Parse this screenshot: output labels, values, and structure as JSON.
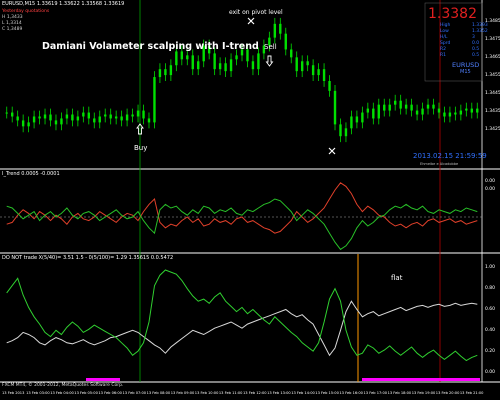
{
  "chart_window": {
    "title": "EURUSD,M15",
    "ohlc": "1.33619 1.33622 1.33568 1.33619",
    "lines": [
      "Yesterday quotations",
      "H 1,3433",
      "L 1,3314",
      "C 1,3489"
    ]
  },
  "overlay_title": "Damiani Volameter scalping with I-trend",
  "annotations": {
    "buy": "Buy",
    "sell": "Sell",
    "exit_pivot": "exit on pivot level",
    "flat": "flat"
  },
  "price_panel": {
    "big_price": "1.3382",
    "stats": [
      {
        "label": "High",
        "value": "1.3393"
      },
      {
        "label": "Low",
        "value": "1.3352"
      },
      {
        "label": "H/L",
        "value": "3"
      },
      {
        "label": "Sprd",
        "value": "0.0"
      },
      {
        "label": "R2",
        "value": "0.5"
      },
      {
        "label": "R1",
        "value": "0.5"
      }
    ],
    "symbol": "EURUSD",
    "timeframe": "M15",
    "datetime": "2013.02.15  21:59:59",
    "footer": "Ehmeibe e Alcadobbe"
  },
  "itrend_panel": {
    "title": "I_Trend 0.0005 -0.0001"
  },
  "damiani_panel": {
    "title": "DO NOT trade X(5/40)= 3.51 1.5 - 0(5/100)= 1.29 1.35615 0.0.5472"
  },
  "footer_copyright": "FXCM MT4, © 2001-2012, MetaQuotes Software Corp.",
  "y_axis_main": [
    "1.3485",
    "1.3475",
    "1.3465",
    "1.3455",
    "1.3445",
    "1.3435",
    "1.3425"
  ],
  "y_axis_itrend": [
    "0.00",
    "0.00"
  ],
  "y_axis_damiani": [
    "1.00",
    "0.80",
    "0.60",
    "0.40",
    "0.20",
    "0.00"
  ],
  "x_axis_labels": [
    "13 Feb 2013",
    "13 Feb 03:00",
    "13 Feb 04:00",
    "13 Feb 05:00",
    "13 Feb 06:00",
    "13 Feb 07:00",
    "13 Feb 08:00",
    "13 Feb 09:00",
    "13 Feb 10:00",
    "13 Feb 11:00",
    "13 Feb 12:00",
    "13 Feb 13:00",
    "13 Feb 14:00",
    "13 Feb 15:00",
    "13 Feb 16:00",
    "13 Feb 17:00",
    "13 Feb 18:00",
    "13 Feb 19:00",
    "13 Feb 20:00",
    "13 Feb 21:00"
  ],
  "colors": {
    "bg": "#000000",
    "candle": "#00e000",
    "itrend_green": "#28c028",
    "itrend_red": "#e0402a",
    "damiani_green": "#30d030",
    "damiani_white": "#d8d8d8",
    "price_red": "#e02020",
    "accent_blue": "#2050ff",
    "vline_green": "#00a000",
    "vline_red": "#b00000",
    "vline_orange": "#ff9900",
    "magenta": "#ff00ff"
  },
  "chart_data": {
    "type": "line",
    "candles_close": [
      1.3444,
      1.3442,
      1.344,
      1.3437,
      1.3439,
      1.3442,
      1.3441,
      1.3443,
      1.344,
      1.3438,
      1.3441,
      1.3443,
      1.344,
      1.3442,
      1.3444,
      1.3441,
      1.3439,
      1.3442,
      1.3443,
      1.3441,
      1.3442,
      1.344,
      1.3443,
      1.3442,
      1.3445,
      1.3441,
      1.3439,
      1.3462,
      1.3466,
      1.3463,
      1.3468,
      1.3475,
      1.3471,
      1.3473,
      1.3466,
      1.347,
      1.3478,
      1.3474,
      1.3466,
      1.3469,
      1.3465,
      1.3471,
      1.3473,
      1.3476,
      1.347,
      1.3466,
      1.3474,
      1.3478,
      1.3482,
      1.3489,
      1.3484,
      1.3476,
      1.3472,
      1.3465,
      1.347,
      1.3468,
      1.3463,
      1.3466,
      1.346,
      1.3455,
      1.3438,
      1.3432,
      1.3436,
      1.3442,
      1.3439,
      1.3444,
      1.3446,
      1.3441,
      1.3448,
      1.3445,
      1.3448,
      1.345,
      1.3446,
      1.3448,
      1.3445,
      1.3443,
      1.3446,
      1.3448,
      1.3446,
      1.3444,
      1.3442,
      1.3444,
      1.3443,
      1.3445,
      1.3446,
      1.3444,
      1.3446
    ],
    "itrend_green": [
      0.6,
      0.5,
      0.2,
      -0.1,
      0.1,
      0.3,
      -0.2,
      0.1,
      0.3,
      0.0,
      0.2,
      0.5,
      0.1,
      -0.1,
      0.2,
      0.3,
      0.1,
      -0.2,
      0.0,
      0.2,
      0.4,
      0.1,
      -0.1,
      0.0,
      0.3,
      -0.2,
      -0.6,
      -0.9,
      0.4,
      0.7,
      0.5,
      0.6,
      0.3,
      0.1,
      0.4,
      0.2,
      0.6,
      0.5,
      0.2,
      0.4,
      0.3,
      0.5,
      0.2,
      0.1,
      0.4,
      0.3,
      0.5,
      0.7,
      0.8,
      1.0,
      0.9,
      0.6,
      0.3,
      -0.2,
      0.1,
      0.4,
      0.2,
      -0.1,
      -0.4,
      -0.9,
      -1.4,
      -1.8,
      -1.6,
      -1.2,
      -0.6,
      -0.2,
      -0.5,
      -0.3,
      0.0,
      0.1,
      0.4,
      0.6,
      0.5,
      0.7,
      0.5,
      0.4,
      0.6,
      0.3,
      0.2,
      0.4,
      0.3,
      0.2,
      0.4,
      0.3,
      0.5,
      0.4,
      0.3
    ],
    "itrend_red": [
      -0.4,
      -0.3,
      0.1,
      0.4,
      0.2,
      -0.1,
      0.3,
      0.1,
      -0.2,
      0.1,
      -0.1,
      -0.4,
      0.0,
      0.2,
      -0.1,
      -0.2,
      0.0,
      0.3,
      0.1,
      -0.1,
      -0.3,
      0.0,
      0.2,
      0.1,
      -0.2,
      0.3,
      0.7,
      1.0,
      -0.3,
      -0.6,
      -0.4,
      -0.5,
      -0.2,
      0.0,
      -0.3,
      -0.1,
      -0.5,
      -0.4,
      -0.1,
      -0.3,
      -0.2,
      -0.4,
      -0.1,
      0.0,
      -0.3,
      -0.2,
      -0.4,
      -0.6,
      -0.7,
      -0.9,
      -0.8,
      -0.5,
      -0.2,
      0.3,
      0.0,
      -0.3,
      -0.1,
      0.2,
      0.5,
      1.0,
      1.5,
      1.9,
      1.7,
      1.3,
      0.7,
      0.3,
      0.6,
      0.4,
      0.1,
      0.0,
      -0.3,
      -0.5,
      -0.4,
      -0.6,
      -0.4,
      -0.3,
      -0.5,
      -0.2,
      -0.1,
      -0.3,
      -0.2,
      -0.1,
      -0.3,
      -0.2,
      -0.4,
      -0.3,
      -0.2
    ],
    "damiani_green": [
      0.78,
      0.85,
      0.92,
      0.76,
      0.64,
      0.55,
      0.48,
      0.4,
      0.36,
      0.42,
      0.38,
      0.45,
      0.5,
      0.46,
      0.4,
      0.43,
      0.47,
      0.44,
      0.41,
      0.38,
      0.35,
      0.3,
      0.25,
      0.18,
      0.22,
      0.3,
      0.5,
      0.85,
      0.95,
      1.0,
      0.98,
      0.96,
      0.9,
      0.82,
      0.75,
      0.7,
      0.72,
      0.68,
      0.74,
      0.78,
      0.7,
      0.65,
      0.6,
      0.64,
      0.58,
      0.62,
      0.57,
      0.52,
      0.48,
      0.55,
      0.5,
      0.45,
      0.4,
      0.36,
      0.3,
      0.26,
      0.22,
      0.3,
      0.5,
      0.72,
      0.82,
      0.7,
      0.42,
      0.26,
      0.18,
      0.2,
      0.28,
      0.25,
      0.2,
      0.23,
      0.27,
      0.22,
      0.18,
      0.22,
      0.26,
      0.2,
      0.16,
      0.2,
      0.23,
      0.18,
      0.14,
      0.18,
      0.22,
      0.17,
      0.13,
      0.16,
      0.18
    ],
    "damiani_white": [
      0.3,
      0.32,
      0.35,
      0.4,
      0.38,
      0.35,
      0.3,
      0.28,
      0.32,
      0.35,
      0.33,
      0.3,
      0.29,
      0.31,
      0.33,
      0.3,
      0.28,
      0.3,
      0.32,
      0.35,
      0.36,
      0.38,
      0.4,
      0.42,
      0.4,
      0.36,
      0.32,
      0.28,
      0.25,
      0.2,
      0.26,
      0.3,
      0.34,
      0.38,
      0.42,
      0.4,
      0.38,
      0.41,
      0.44,
      0.46,
      0.48,
      0.5,
      0.47,
      0.44,
      0.48,
      0.5,
      0.52,
      0.54,
      0.56,
      0.58,
      0.6,
      0.62,
      0.58,
      0.55,
      0.57,
      0.52,
      0.48,
      0.38,
      0.28,
      0.18,
      0.25,
      0.42,
      0.6,
      0.7,
      0.62,
      0.55,
      0.58,
      0.6,
      0.56,
      0.58,
      0.6,
      0.62,
      0.64,
      0.61,
      0.63,
      0.65,
      0.66,
      0.64,
      0.66,
      0.67,
      0.65,
      0.66,
      0.68,
      0.66,
      0.67,
      0.68,
      0.67
    ]
  }
}
